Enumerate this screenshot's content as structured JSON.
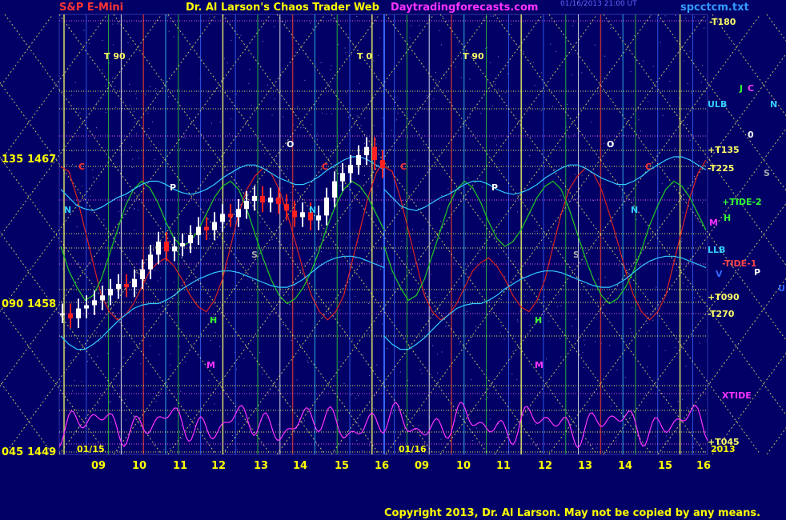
{
  "header": {
    "symbol": "S&P E-Mini",
    "author": "Dr. Al Larson's Chaos Trader Web",
    "site": "Daytradingforecasts.com",
    "stamp": "01/16/2013 21:00 UT",
    "file": "spcctcm.txt"
  },
  "footer": {
    "copyright": "Copyright 2013, Dr. Al Larson. May not be copied by any means."
  },
  "colors": {
    "background": "#000066",
    "price_up": "#ffffff",
    "price_down": "#ff2020",
    "grid_yellow": "#ffff66",
    "flux_green": "#22cc22",
    "flux_red": "#dd2222",
    "flux_cyan": "#33ccff",
    "xtide_magenta": "#ff33ff",
    "axis_text": "#ffff00"
  },
  "chart_data": {
    "type": "line",
    "title": "S&P E-Mini",
    "y_axis_left": [
      {
        "angle": "135",
        "price": "1467"
      },
      {
        "angle": "090",
        "price": "1458"
      },
      {
        "angle": "045",
        "price": "1449"
      }
    ],
    "ylim": [
      1449,
      1467
    ],
    "x_ticks": [
      "09",
      "10",
      "11",
      "12",
      "13",
      "14",
      "15",
      "16",
      "09",
      "10",
      "11",
      "12",
      "13",
      "14",
      "15",
      "16"
    ],
    "date_labels": [
      "01/15",
      "01/16",
      "2013"
    ],
    "right_labels": [
      {
        "text": "-T180",
        "color": "#ffff66"
      },
      {
        "text": "ULB",
        "color": "#33ccff"
      },
      {
        "text": "+T135",
        "color": "#ffff66"
      },
      {
        "text": "-T225",
        "color": "#ffff66"
      },
      {
        "text": "+TIDE-2",
        "color": "#33ff33"
      },
      {
        "text": "LLB",
        "color": "#33ccff"
      },
      {
        "text": "-TIDE-1",
        "color": "#ff4444"
      },
      {
        "text": "+T090",
        "color": "#ffff66"
      },
      {
        "text": "-T270",
        "color": "#ffff66"
      },
      {
        "text": "XTIDE",
        "color": "#ff33ff"
      },
      {
        "text": "+T045",
        "color": "#ffff66"
      }
    ],
    "planet_letters": [
      {
        "text": "J",
        "color": "#33ff33"
      },
      {
        "text": "C",
        "color": "#ff33ff"
      },
      {
        "text": "N",
        "color": "#33ccff"
      },
      {
        "text": "0",
        "color": "#ffffff"
      },
      {
        "text": "S",
        "color": "#aaaaaa"
      },
      {
        "text": "H",
        "color": "#33ff33"
      },
      {
        "text": "M",
        "color": "#ff33ff"
      },
      {
        "text": "P",
        "color": "#ffffff"
      },
      {
        "text": "V",
        "color": "#3366ff"
      },
      {
        "text": "U",
        "color": "#3366ff"
      }
    ],
    "in_chart_letters": [
      {
        "text": "T  90",
        "color": "#ffff66"
      },
      {
        "text": "T  0",
        "color": "#ffff66"
      },
      {
        "text": "T  90",
        "color": "#ffff66"
      },
      {
        "text": "N",
        "color": "#33ccff"
      },
      {
        "text": "N",
        "color": "#33ccff"
      },
      {
        "text": "N",
        "color": "#33ccff"
      },
      {
        "text": "P",
        "color": "#ffffff"
      },
      {
        "text": "P",
        "color": "#ffffff"
      },
      {
        "text": "O",
        "color": "#ffffff"
      },
      {
        "text": "O",
        "color": "#ffffff"
      },
      {
        "text": "S",
        "color": "#aaaaaa"
      },
      {
        "text": "S",
        "color": "#aaaaaa"
      },
      {
        "text": "H",
        "color": "#33ff33"
      },
      {
        "text": "H",
        "color": "#33ff33"
      },
      {
        "text": "M",
        "color": "#ff33ff"
      },
      {
        "text": "M",
        "color": "#ff33ff"
      },
      {
        "text": "C",
        "color": "#ff3333"
      },
      {
        "text": "C",
        "color": "#ff3333"
      },
      {
        "text": "C",
        "color": "#ff3333"
      },
      {
        "text": "C",
        "color": "#ff3333"
      }
    ],
    "series": [
      {
        "name": "price",
        "values": [
          1457.5,
          1457.2,
          1457.8,
          1458.0,
          1458.3,
          1458.6,
          1459.0,
          1459.3,
          1459.1,
          1459.6,
          1460.2,
          1461.1,
          1461.9,
          1461.3,
          1461.6,
          1461.8,
          1462.3,
          1462.8,
          1462.6,
          1463.1,
          1463.6,
          1463.4,
          1463.9,
          1464.4,
          1464.7,
          1464.3,
          1464.6,
          1464.2,
          1463.8,
          1463.4,
          1463.7,
          1463.2,
          1463.5,
          1464.6,
          1465.6,
          1466.1,
          1466.6,
          1467.2,
          1467.7,
          1466.9,
          1466.4
        ]
      },
      {
        "name": "-TIDE-1",
        "values": [
          1466.5,
          1466.2,
          1464.6,
          1462.6,
          1460.6,
          1458.6,
          1457.6,
          1457.1,
          1457.4,
          1458.1,
          1459.1,
          1460.1,
          1460.6,
          1460.9,
          1460.4,
          1459.6,
          1458.6,
          1457.9,
          1457.6,
          1458.3,
          1459.6,
          1461.6,
          1463.6,
          1465.1,
          1465.9,
          1466.4,
          1466.1,
          1465.1,
          1463.6,
          1461.9,
          1460.1,
          1458.6,
          1457.6,
          1457.1,
          1457.6,
          1458.6,
          1460.6,
          1462.6,
          1464.6,
          1466.1,
          1466.9
        ]
      },
      {
        "name": "+TIDE-2",
        "values": [
          1461.6,
          1460.1,
          1459.1,
          1458.3,
          1458.6,
          1459.6,
          1461.1,
          1462.6,
          1464.1,
          1465.1,
          1465.6,
          1465.2,
          1464.3,
          1463.1,
          1462.1,
          1461.6,
          1461.9,
          1462.6,
          1463.6,
          1464.6,
          1465.3,
          1465.6,
          1465.1,
          1463.9,
          1462.4,
          1460.9,
          1459.6,
          1458.6,
          1458.1,
          1458.4,
          1459.1,
          1460.1,
          1461.4,
          1462.9,
          1464.1,
          1465.1,
          1465.6,
          1465.3,
          1464.6,
          1463.6,
          1462.6
        ]
      },
      {
        "name": "ULB",
        "values": [
          1465.1,
          1464.6,
          1464.1,
          1463.9,
          1463.8,
          1464.0,
          1464.3,
          1464.6,
          1464.8,
          1465.1,
          1465.4,
          1465.6,
          1465.6,
          1465.4,
          1465.1,
          1464.9,
          1464.8,
          1464.9,
          1465.1,
          1465.4,
          1465.8,
          1466.1,
          1466.4,
          1466.6,
          1466.6,
          1466.4,
          1466.1,
          1465.8,
          1465.6,
          1465.4,
          1465.4,
          1465.6,
          1465.9,
          1466.3,
          1466.6,
          1466.9,
          1467.1,
          1467.1,
          1466.9,
          1466.6,
          1466.3
        ]
      },
      {
        "name": "LLB",
        "values": [
          1456.1,
          1455.6,
          1455.3,
          1455.3,
          1455.6,
          1456.0,
          1456.5,
          1457.0,
          1457.4,
          1457.8,
          1458.0,
          1458.1,
          1458.1,
          1458.3,
          1458.6,
          1459.0,
          1459.3,
          1459.6,
          1459.8,
          1460.0,
          1460.1,
          1460.1,
          1460.0,
          1459.8,
          1459.6,
          1459.4,
          1459.2,
          1459.1,
          1459.1,
          1459.3,
          1459.6,
          1460.0,
          1460.4,
          1460.7,
          1460.9,
          1461.0,
          1461.0,
          1460.9,
          1460.7,
          1460.5,
          1460.3
        ]
      }
    ],
    "grid": true
  }
}
